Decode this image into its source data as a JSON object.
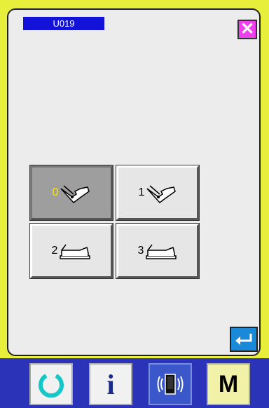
{
  "screen": {
    "code": "U019",
    "icons": {
      "close": "close-icon",
      "enter": "enter-icon"
    },
    "options": [
      {
        "label": "0",
        "icon": "pedal-tilted-icon",
        "selected": true
      },
      {
        "label": "1",
        "icon": "pedal-tilted-icon",
        "selected": false
      },
      {
        "label": "2",
        "icon": "pedal-flat-icon",
        "selected": false
      },
      {
        "label": "3",
        "icon": "pedal-flat-icon",
        "selected": false
      }
    ]
  },
  "bottom_bar": {
    "items": [
      {
        "icon": "ready-icon"
      },
      {
        "icon": "information-icon",
        "label": "i"
      },
      {
        "icon": "communication-icon"
      },
      {
        "icon": "mode-icon",
        "label": "M"
      }
    ]
  },
  "colors": {
    "background": "#e8ef3a",
    "panel": "#ececec",
    "code_box": "#1212d8",
    "close_button": "#ee40ee",
    "enter_button": "#1a8ad8",
    "selected_button": "#9e9e9e",
    "selected_number": "#ffe800",
    "bottom_bar": "#2b34b8",
    "ready_icon": "#15c8c8"
  }
}
